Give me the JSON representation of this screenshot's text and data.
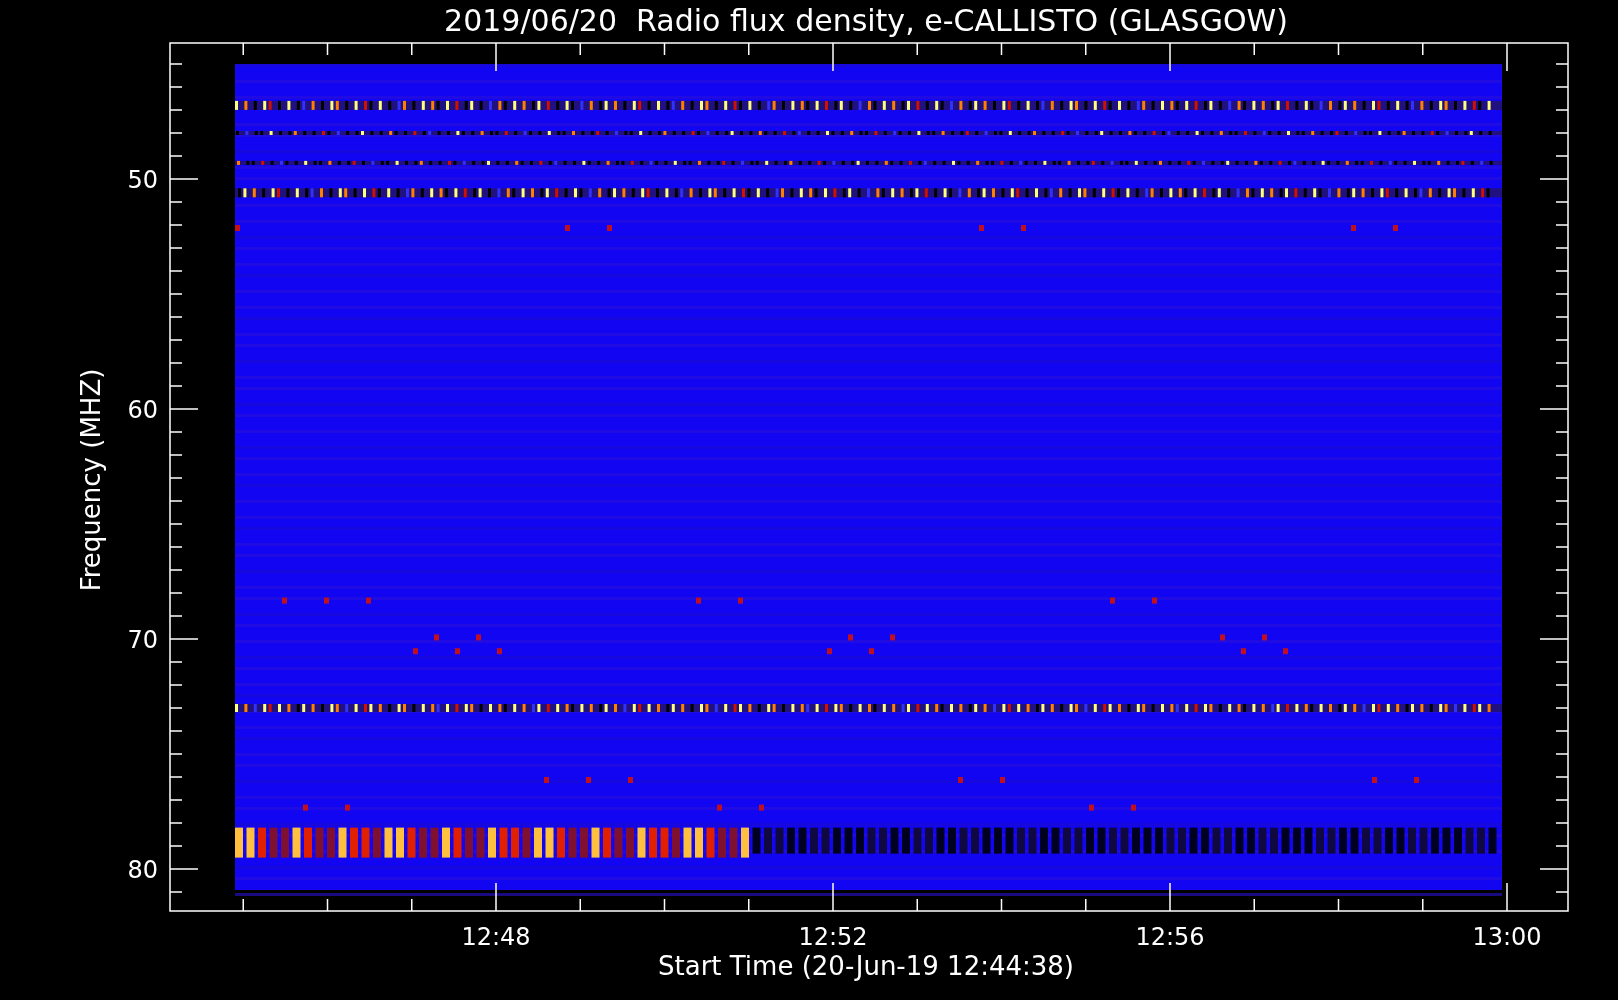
{
  "title": "2019/06/20  Radio flux density, e-CALLISTO (GLASGOW)",
  "y_axis": {
    "label": "Frequency (MHZ)",
    "ticks": [
      "50",
      "60",
      "70",
      "80"
    ]
  },
  "x_axis": {
    "label": "Start Time (20-Jun-19 12:44:38)",
    "ticks": [
      "12:48",
      "12:52",
      "12:56",
      "13:00"
    ]
  }
}
